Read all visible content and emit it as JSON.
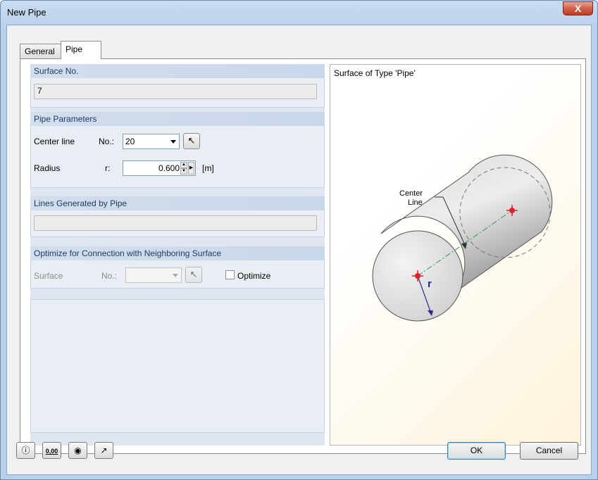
{
  "window": {
    "title": "New Pipe",
    "close_glyph": "X"
  },
  "tabs": [
    {
      "label": "General",
      "selected": false
    },
    {
      "label": "Pipe",
      "selected": true
    }
  ],
  "surface_no": {
    "header": "Surface No.",
    "value": "7"
  },
  "pipe_parameters": {
    "header": "Pipe Parameters",
    "center_line_label": "Center line",
    "no_label": "No.:",
    "center_line_no": "20",
    "radius_label": "Radius",
    "r_label": "r:",
    "radius_value": "0.600",
    "radius_unit": "[m]"
  },
  "lines_generated": {
    "header": "Lines Generated by Pipe",
    "value": ""
  },
  "optimize": {
    "header": "Optimize for Connection with Neighboring Surface",
    "surface_label": "Surface",
    "no_label": "No.:",
    "no_value": "",
    "checkbox_label": "Optimize",
    "checked": false
  },
  "preview": {
    "title": "Surface of Type 'Pipe'",
    "center_line_label_1": "Center",
    "center_line_label_2": "Line",
    "r_label": "r"
  },
  "buttons": {
    "ok": "OK",
    "cancel": "Cancel"
  },
  "footer_icons": [
    "help-icon",
    "units-icon",
    "view-icon",
    "pick-icon"
  ],
  "colors": {
    "accent": "#c0391f",
    "group_header": "#d2deec",
    "node": "#e0202a",
    "axis": "#2a9a4a"
  }
}
